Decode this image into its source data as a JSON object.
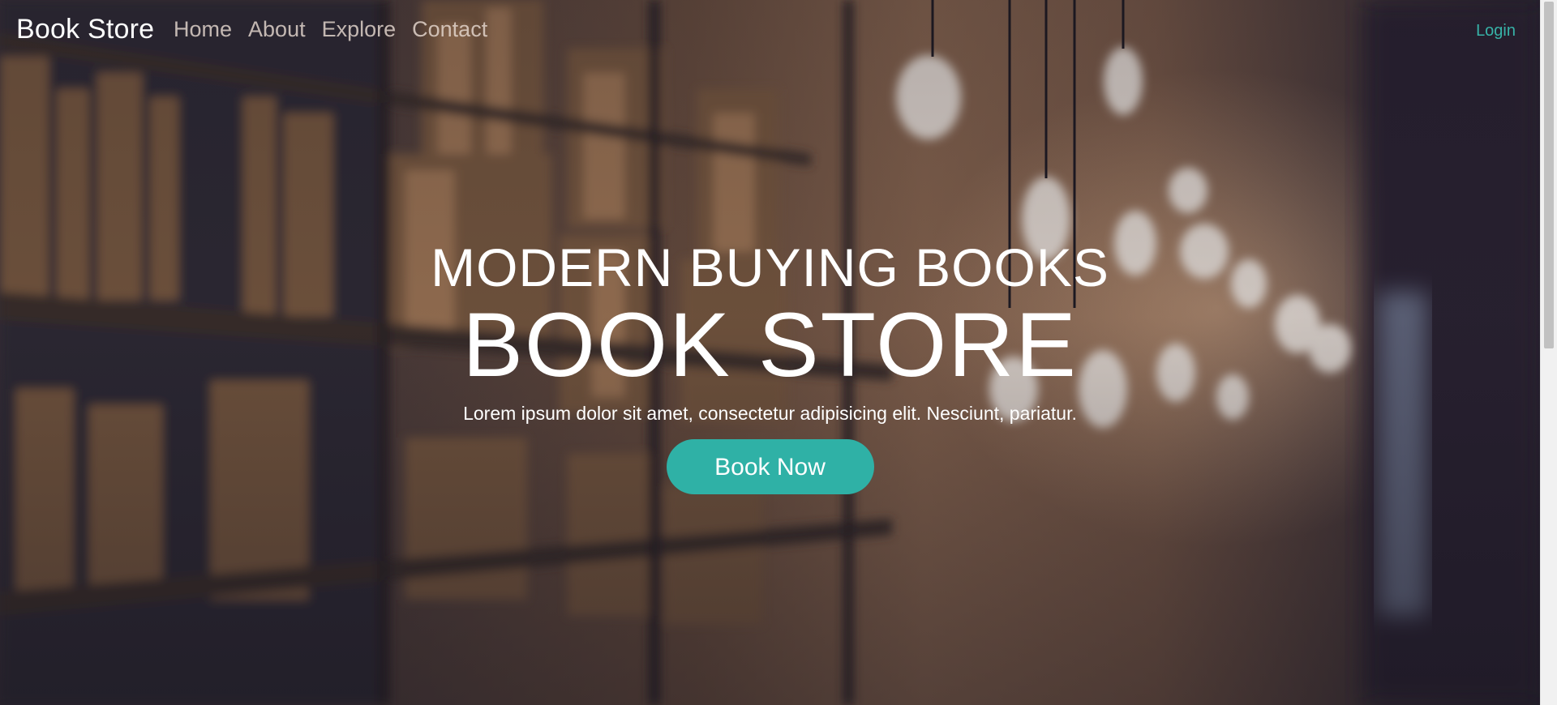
{
  "nav": {
    "brand": "Book Store",
    "links": [
      "Home",
      "About",
      "Explore",
      "Contact"
    ],
    "login": "Login"
  },
  "hero": {
    "eyebrow": "MODERN BUYING BOOKS",
    "title": "BOOK STORE",
    "description": "Lorem ipsum dolor sit amet, consectetur adipisicing elit. Nesciunt, pariatur.",
    "cta": "Book Now"
  },
  "colors": {
    "accent": "#2fb1a6",
    "login": "#37b3a8",
    "text": "#ffffff"
  },
  "background": {
    "image": "blurred-library-bookshelves-with-hanging-bulbs"
  }
}
